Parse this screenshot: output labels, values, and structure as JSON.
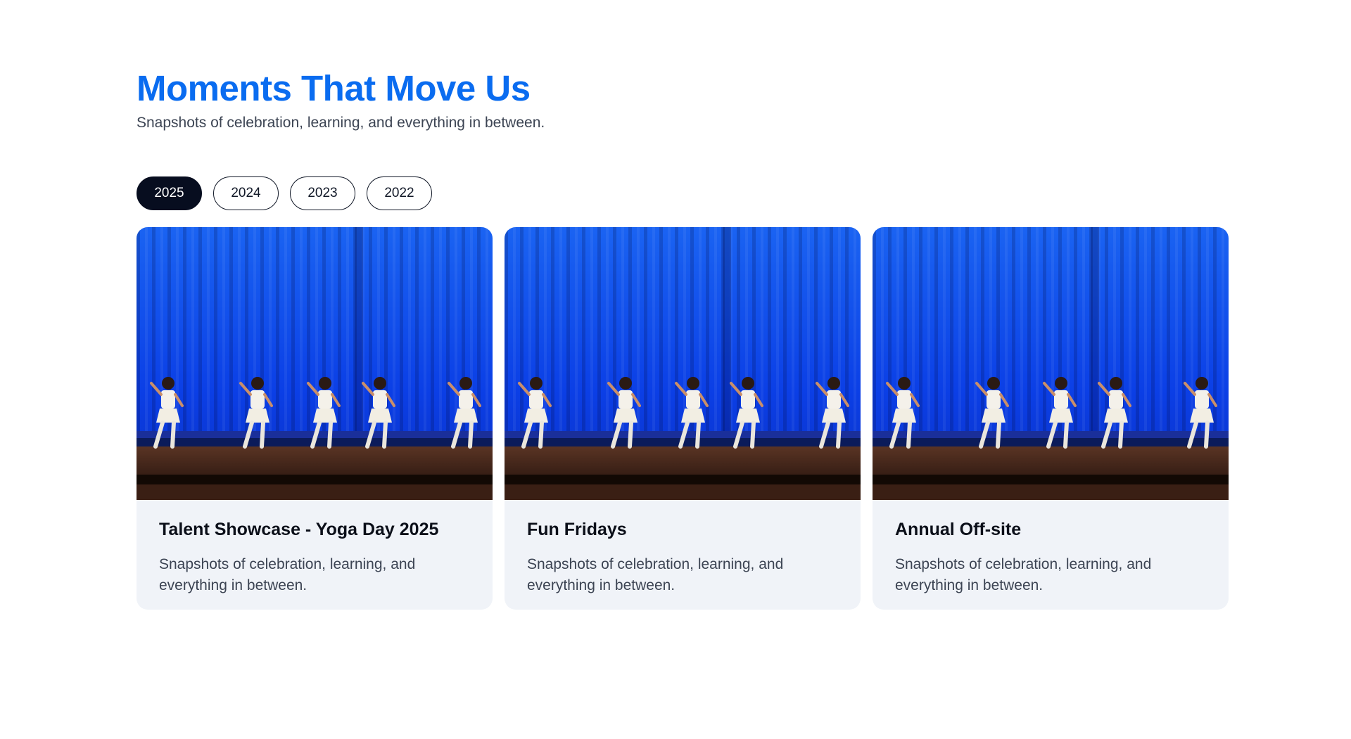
{
  "header": {
    "title": "Moments That Move Us",
    "subtitle": "Snapshots of celebration, learning, and everything in between."
  },
  "year_tabs": [
    {
      "label": "2025",
      "active": true
    },
    {
      "label": "2024",
      "active": false
    },
    {
      "label": "2023",
      "active": false
    },
    {
      "label": "2022",
      "active": false
    }
  ],
  "cards": [
    {
      "title": "Talent Showcase - Yoga Day 2025",
      "description": "Snapshots of celebration, learning, and everything in between.",
      "image": "stage-dance-photo"
    },
    {
      "title": "Fun Fridays",
      "description": "Snapshots of celebration, learning, and everything in between.",
      "image": "stage-dance-photo"
    },
    {
      "title": "Annual Off-site",
      "description": "Snapshots of celebration, learning, and everything in between.",
      "image": "stage-dance-photo"
    }
  ],
  "colors": {
    "accent": "#0a6cf0",
    "active_tab": "#070d1f",
    "card_bg": "#f0f3f8",
    "curtain": "#0b3fe6"
  }
}
